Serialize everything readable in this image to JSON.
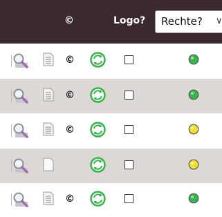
{
  "header": {
    "copyright_symbol": "©",
    "logo_label": "Logo?",
    "rights_select_value": "Rechte?"
  },
  "rows": [
    {
      "copyright": "©",
      "doc_type": "text",
      "status": "green",
      "checked": false
    },
    {
      "copyright": "©",
      "doc_type": "text",
      "status": "green",
      "checked": false
    },
    {
      "copyright": "©",
      "doc_type": "text",
      "status": "yellow",
      "checked": false
    },
    {
      "copyright": "",
      "doc_type": "blank",
      "status": "yellow",
      "checked": false
    },
    {
      "copyright": "©",
      "doc_type": "text",
      "status": "green",
      "checked": false
    }
  ],
  "colors": {
    "header_bg": "#3a2930",
    "alt_row_bg": "#ddd8d5",
    "status_green": "#35b54a",
    "status_yellow": "#f0e22c",
    "sync_green": "#34b44a"
  },
  "icons": {
    "view": "magnifier-icon",
    "document": "document-icon",
    "sync": "sync-icon",
    "status": "status-dot-icon"
  }
}
